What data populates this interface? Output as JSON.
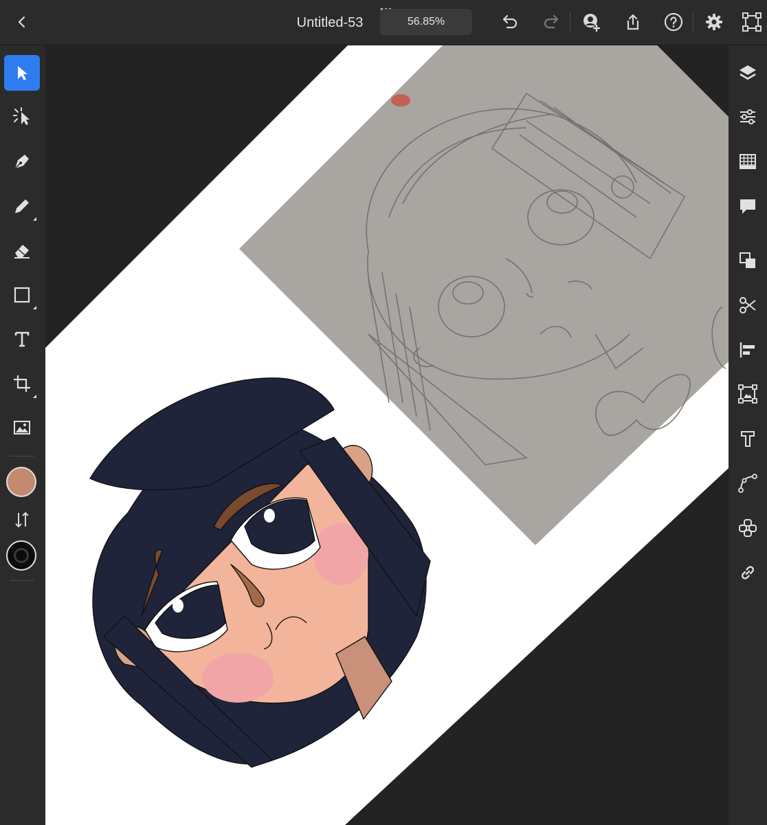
{
  "document": {
    "title": "Untitled-53",
    "zoom": "56.85%",
    "more_label": "•••"
  },
  "colors": {
    "accent": "#2f7bf0",
    "fill_swatch": "#c38a70",
    "stroke_swatch": "#0c0c0c",
    "hair": "#1f243a",
    "skin": "#f2b49a",
    "ear": "#d9a287",
    "blush": "#f1a5a7",
    "brow": "#7a4a2e",
    "neck": "#c9917a",
    "sketch_paper": "#a9a6a2"
  },
  "topbar_icons": [
    "back-chevron-icon",
    "undo-icon",
    "redo-icon",
    "invite-user-icon",
    "share-icon",
    "help-icon",
    "settings-gear-icon",
    "artboard-select-icon"
  ],
  "left_tools": [
    "selection-arrow-icon",
    "direct-selection-icon",
    "pen-icon",
    "pencil-icon",
    "eraser-icon",
    "rectangle-icon",
    "type-icon",
    "artboard-icon",
    "image-icon"
  ],
  "right_tools": [
    "layers-icon",
    "properties-sliders-icon",
    "swatches-grid-icon",
    "comments-icon",
    "arrange-icon",
    "scissors-icon",
    "align-icon",
    "crop-image-icon",
    "type-outline-icon",
    "path-curve-icon",
    "repeat-grid-icon",
    "link-icon"
  ]
}
